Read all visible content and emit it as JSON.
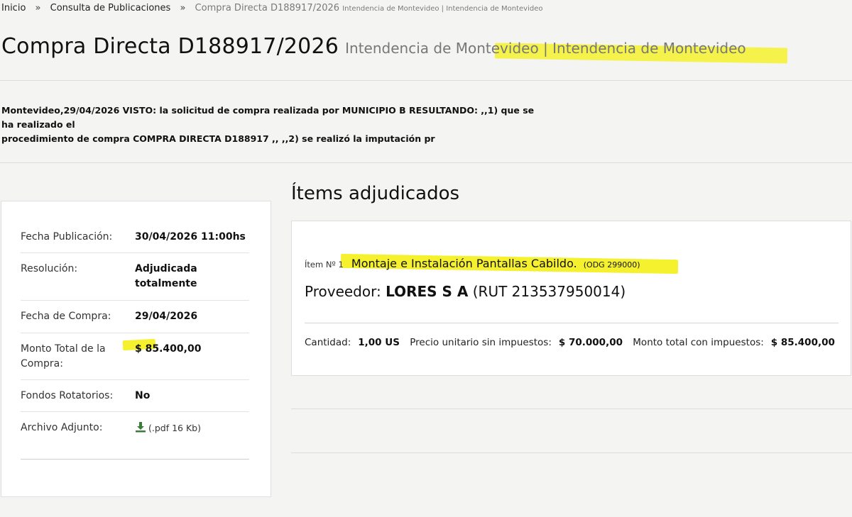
{
  "breadcrumb": {
    "home": "Inicio",
    "section": "Consulta de Publicaciones",
    "current": "Compra Directa D188917/2026",
    "current_org": "Intendencia de Montevideo | Intendencia de Montevideo"
  },
  "header": {
    "title": "Compra Directa D188917/2026",
    "subtitle": "Intendencia de Montevideo | Intendencia de Montevideo"
  },
  "description": {
    "line1": "Montevideo,29/04/2026 VISTO: la solicitud de compra realizada por MUNICIPIO B RESULTANDO: ,,1) que se ha realizado el",
    "line2": "procedimiento de compra COMPRA DIRECTA D188917 ,, ,,2) se realizó la imputación pr"
  },
  "info": {
    "fecha_publicacion": {
      "label": "Fecha Publicación:",
      "value": "30/04/2026 11:00hs"
    },
    "resolucion": {
      "label": "Resolución:",
      "value_line1": "Adjudicada",
      "value_line2": "totalmente"
    },
    "fecha_compra": {
      "label": "Fecha de Compra:",
      "value": "29/04/2026"
    },
    "monto_total": {
      "label_line1": "Monto Total de la",
      "label_line2": "Compra:",
      "value": "$ 85.400,00"
    },
    "fondos_rotatorios": {
      "label": "Fondos Rotatorios:",
      "value": "No"
    },
    "archivo_adjunto": {
      "label": "Archivo Adjunto:",
      "value": "(.pdf 16 Kb)",
      "icon": "download-icon"
    }
  },
  "items": {
    "heading": "Ítems adjudicados",
    "list": [
      {
        "number_label": "Ítem Nº 1",
        "description": "Montaje e Instalación Pantallas Cabildo.",
        "odg": "(ODG 299000)",
        "provider_label": "Proveedor:",
        "provider_name": "LORES S A",
        "provider_rut": "(RUT 213537950014)",
        "cantidad_label": "Cantidad:",
        "cantidad_value": "1,00 US",
        "precio_label": "Precio unitario sin impuestos:",
        "precio_value": "$ 70.000,00",
        "monto_label": "Monto total con impuestos:",
        "monto_value": "$ 85.400,00"
      }
    ]
  },
  "colors": {
    "background": "#f4f5f3",
    "highlight": "#f6f12e",
    "download_icon": "#3a7d3a"
  }
}
